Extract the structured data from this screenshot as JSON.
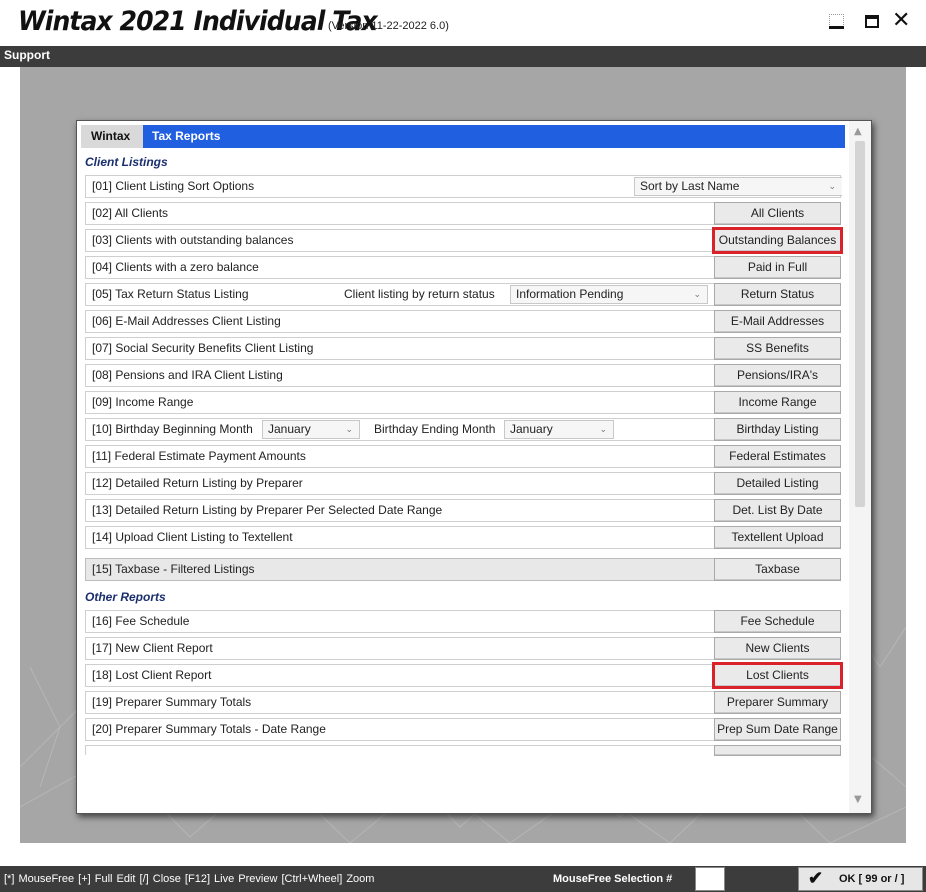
{
  "window": {
    "title": "Wintax 2021 Individual Tax",
    "version": "(Version 11-22-2022 6.0)",
    "controls": {
      "minimize": "minimize-icon",
      "maximize": "maximize-icon",
      "close": "close-icon",
      "close_glyph": "✕"
    }
  },
  "menu": {
    "support": "Support"
  },
  "panel": {
    "header_tab": "Wintax",
    "header_title": "Tax Reports",
    "accent_color": "#1f5fe0"
  },
  "sections": {
    "client_listings": "Client Listings",
    "other_reports": "Other Reports"
  },
  "rows": [
    {
      "label": "[01] Client Listing Sort Options",
      "select_value": "Sort by Last Name"
    },
    {
      "label": "[02] All Clients",
      "button": "All Clients"
    },
    {
      "label": "[03] Clients with outstanding balances",
      "button": "Outstanding Balances",
      "highlighted": true
    },
    {
      "label": "[04] Clients with a zero balance",
      "button": "Paid in Full"
    },
    {
      "label": "[05] Tax Return Status Listing",
      "sub_label": "Client listing by return status",
      "select_value": "Information Pending",
      "button": "Return Status"
    },
    {
      "label": "[06] E-Mail Addresses Client Listing",
      "button": "E-Mail Addresses"
    },
    {
      "label": "[07] Social Security Benefits Client Listing",
      "button": "SS Benefits"
    },
    {
      "label": "[08] Pensions and IRA Client Listing",
      "button": "Pensions/IRA's"
    },
    {
      "label": "[09] Income Range",
      "button": "Income Range"
    },
    {
      "label": "[10] Birthday Beginning Month",
      "select_value": "January",
      "sub_label": "Birthday Ending Month",
      "select_value_2": "January",
      "button": "Birthday Listing"
    },
    {
      "label": "[11] Federal Estimate Payment Amounts",
      "button": "Federal Estimates"
    },
    {
      "label": "[12] Detailed Return Listing by Preparer",
      "button": "Detailed Listing"
    },
    {
      "label": "[13] Detailed Return Listing by Preparer Per Selected Date Range",
      "button": "Det. List By Date"
    },
    {
      "label": "[14] Upload Client Listing to Textellent",
      "button": "Textellent Upload"
    },
    {
      "label": "[15] Taxbase - Filtered Listings",
      "button": "Taxbase"
    },
    {
      "label": "[16] Fee Schedule",
      "button": "Fee Schedule"
    },
    {
      "label": "[17] New Client Report",
      "button": "New Clients"
    },
    {
      "label": "[18] Lost Client Report",
      "button": "Lost Clients",
      "highlighted": true
    },
    {
      "label": "[19] Preparer Summary Totals",
      "button": "Preparer Summary"
    },
    {
      "label": "[20] Preparer Summary Totals - Date Range",
      "button": "Prep Sum Date Range"
    }
  ],
  "highlight_color": "#d9222a",
  "statusbar": {
    "hints": "[*] MouseFree   [+] Full Edit   [/] Close   [F12] Live Preview   [Ctrl+Wheel] Zoom",
    "mousefree_label": "MouseFree Selection #",
    "mousefree_value": "",
    "ok_label": "OK [ 99 or / ]",
    "check_glyph": "✔"
  }
}
